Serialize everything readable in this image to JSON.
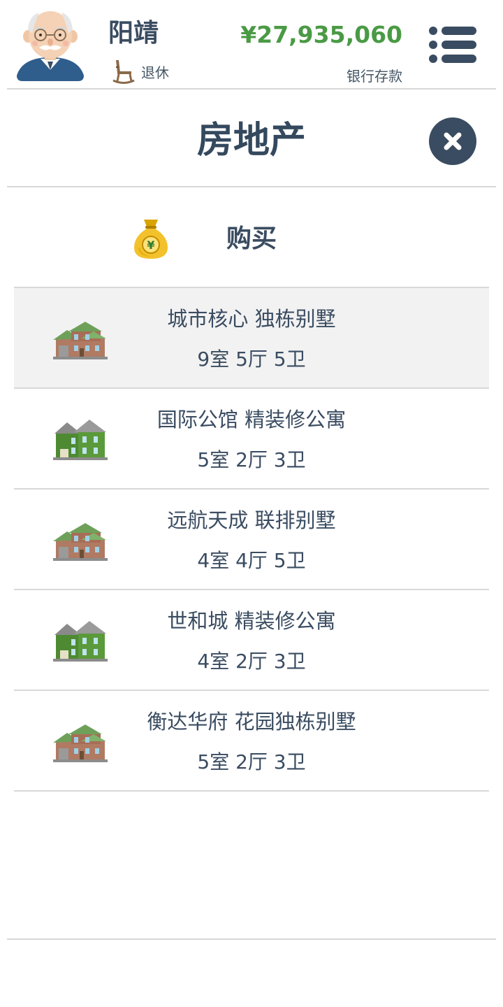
{
  "header": {
    "player_name": "阳靖",
    "status_label": "退休",
    "status_icon": "rocking-chair-icon",
    "money": "¥27,935,060",
    "money_label": "银行存款",
    "money_color": "#4a9a45",
    "menu_icon": "list-menu-icon"
  },
  "page": {
    "title": "房地产",
    "close_icon": "close-icon"
  },
  "buy": {
    "label": "购买",
    "icon": "money-bag-icon"
  },
  "properties": [
    {
      "name": "城市核心 独栋别墅",
      "rooms": "9室 5厅 5卫",
      "icon": "villa-house-icon",
      "selected": true
    },
    {
      "name": "国际公馆 精装修公寓",
      "rooms": "5室 2厅 3卫",
      "icon": "apartment-house-icon",
      "selected": false
    },
    {
      "name": "远航天成 联排别墅",
      "rooms": "4室 4厅 5卫",
      "icon": "villa-house-icon",
      "selected": false
    },
    {
      "name": "世和城 精装修公寓",
      "rooms": "4室 2厅 3卫",
      "icon": "apartment-house-icon",
      "selected": false
    },
    {
      "name": "衡达华府 花园独栋别墅",
      "rooms": "5室 2厅 3卫",
      "icon": "villa-house-icon",
      "selected": false
    }
  ],
  "colors": {
    "text_dark": "#3a4c61",
    "divider": "#d8d8d8",
    "selected_row": "#f2f2f2"
  }
}
